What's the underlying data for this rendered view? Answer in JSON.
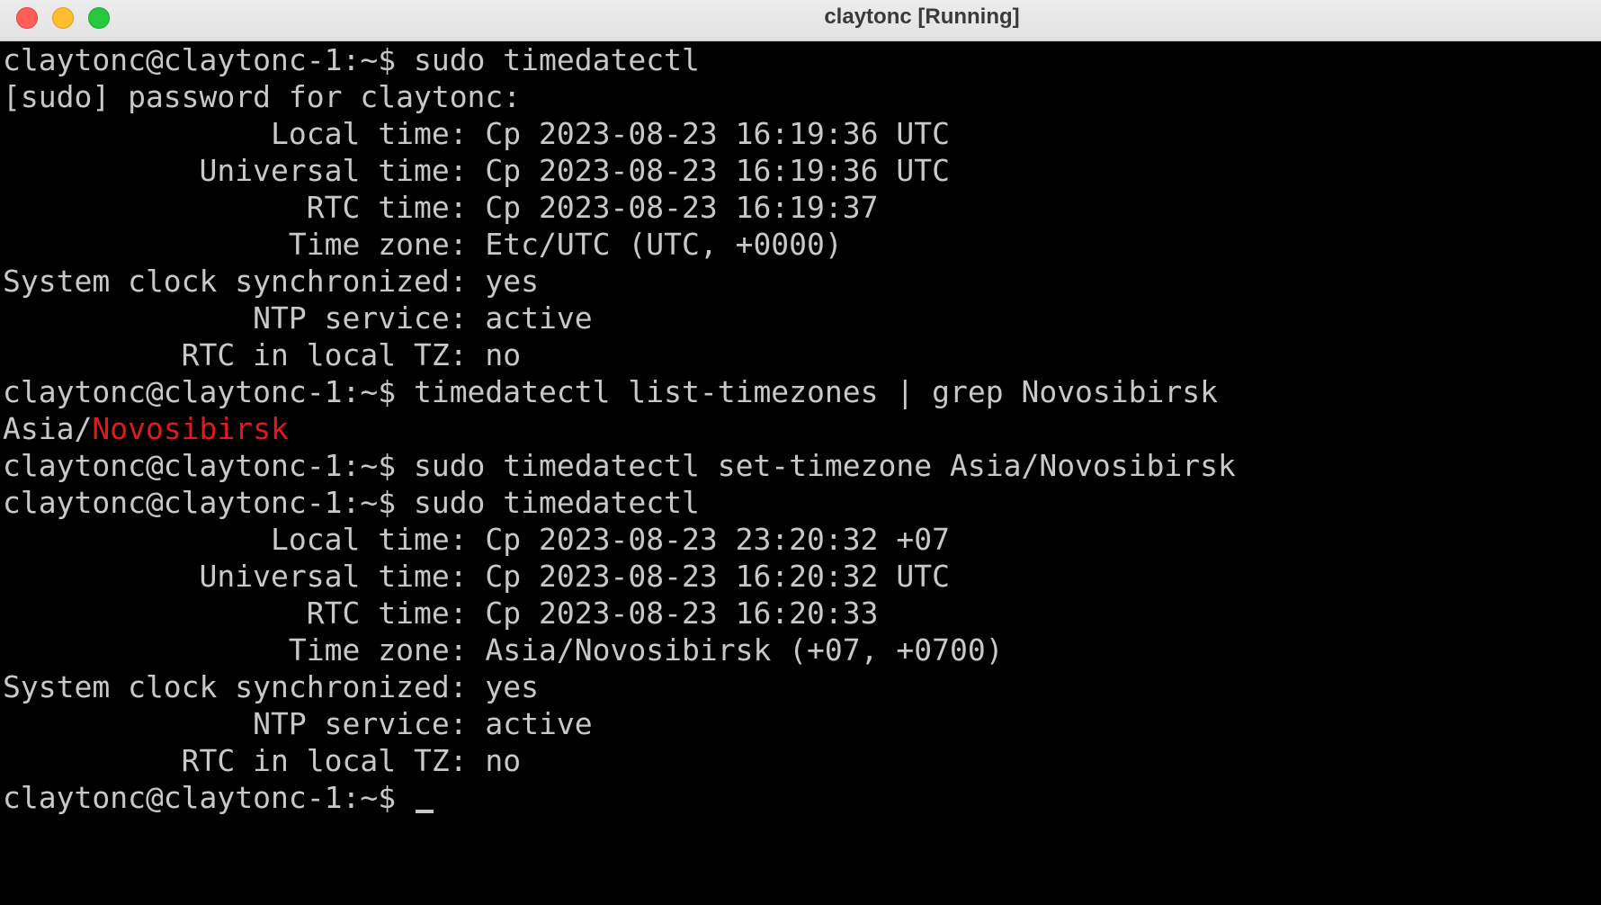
{
  "window": {
    "title": "claytonc [Running]"
  },
  "terminal": {
    "lines": [
      "claytonc@claytonc-1:~$ sudo timedatectl",
      "[sudo] password for claytonc:",
      "               Local time: Ср 2023-08-23 16:19:36 UTC",
      "           Universal time: Ср 2023-08-23 16:19:36 UTC",
      "                 RTC time: Ср 2023-08-23 16:19:37",
      "                Time zone: Etc/UTC (UTC, +0000)",
      "System clock synchronized: yes",
      "              NTP service: active",
      "          RTC in local TZ: no",
      "claytonc@claytonc-1:~$ timedatectl list-timezones | grep Novosibirsk",
      "",
      "claytonc@claytonc-1:~$ sudo timedatectl set-timezone Asia/Novosibirsk",
      "claytonc@claytonc-1:~$ sudo timedatectl",
      "               Local time: Ср 2023-08-23 23:20:32 +07",
      "           Universal time: Ср 2023-08-23 16:20:32 UTC",
      "                 RTC time: Ср 2023-08-23 16:20:33",
      "                Time zone: Asia/Novosibirsk (+07, +0700)",
      "System clock synchronized: yes",
      "              NTP service: active",
      "          RTC in local TZ: no",
      "claytonc@claytonc-1:~$ "
    ],
    "grep_result": {
      "prefix": "Asia/",
      "match": "Novosibirsk"
    },
    "colors": {
      "foreground": "#c8c8c8",
      "background": "#000000",
      "grep_match": "#e01b1b"
    }
  }
}
